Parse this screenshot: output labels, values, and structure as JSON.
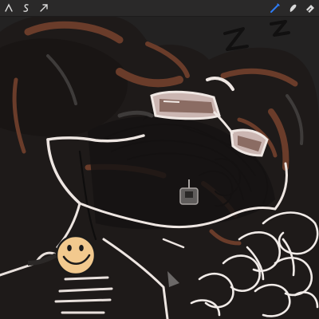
{
  "app": {
    "toolbar": {
      "left_tools": [
        {
          "name": "adjustments-icon"
        },
        {
          "name": "selection-icon"
        },
        {
          "name": "transform-icon"
        }
      ],
      "right_tools": [
        {
          "name": "brush-icon",
          "active": true
        },
        {
          "name": "smudge-icon",
          "active": false
        },
        {
          "name": "eraser-icon",
          "active": false
        }
      ]
    },
    "colors": {
      "toolbar_bg": "#2a2929",
      "icon": "#d9d9d9",
      "active_tool": "#2e7cf6",
      "canvas_bg": "#232222"
    },
    "canvas": {
      "sleep_text": "Z Z"
    }
  }
}
